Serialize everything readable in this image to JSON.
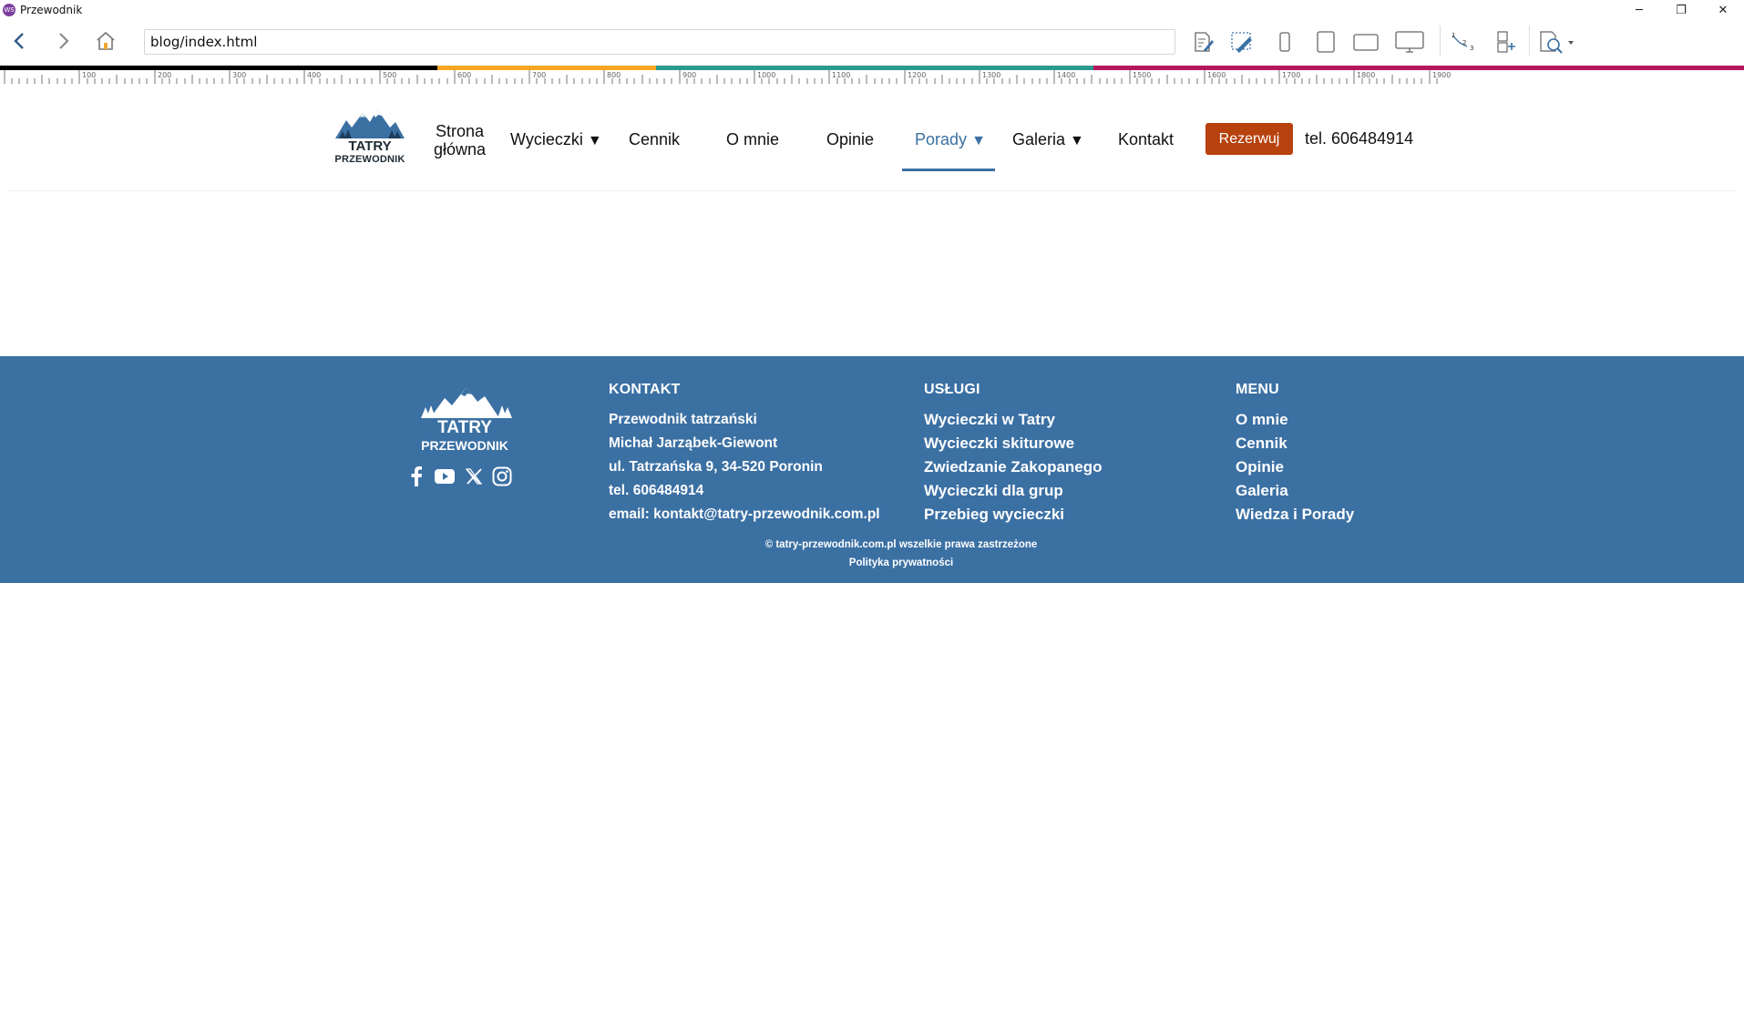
{
  "window": {
    "title": "Przewodnik",
    "app_icon": "WS",
    "minimize_icon": "─",
    "restore_icon": "❐",
    "close_icon": "✕"
  },
  "toolbar": {
    "address": "blog/index.html"
  },
  "ruler": {
    "labels": [
      "100",
      "200",
      "300",
      "400",
      "500",
      "600",
      "700",
      "800",
      "900",
      "1000",
      "1100",
      "1200",
      "1300",
      "1400",
      "1500",
      "1600",
      "1700",
      "1800",
      "1900"
    ],
    "band_colors": [
      "#000000",
      "#f5a623",
      "#2b9b8f",
      "#b5175c"
    ]
  },
  "header": {
    "logo_line1": "TATRY",
    "logo_line2": "PRZEWODNIK",
    "menu": {
      "home_line1": "Strona",
      "home_line2": "główna",
      "tours": "Wycieczki",
      "pricing": "Cennik",
      "about": "O mnie",
      "reviews": "Opinie",
      "tips": "Porady",
      "gallery": "Galeria",
      "contact": "Kontakt"
    },
    "caret": "▼",
    "reserve_label": "Rezerwuj",
    "phone": "tel. 606484914",
    "accent_color": "#3b70a3",
    "button_color": "#b7420e"
  },
  "footer": {
    "background": "#3b70a3",
    "logo_line1": "TATRY",
    "logo_line2": "PRZEWODNIK",
    "contact": {
      "heading": "KONTAKT",
      "lines": [
        "Przewodnik tatrzański",
        "Michał Jarząbek-Giewont",
        "ul. Tatrzańska 9, 34-520 Poronin",
        "tel. 606484914",
        "email: kontakt@tatry-przewodnik.com.pl"
      ]
    },
    "services": {
      "heading": "USŁUGI",
      "links": [
        "Wycieczki w Tatry",
        "Wycieczki skiturowe",
        "Zwiedzanie Zakopanego",
        "Wycieczki dla grup",
        "Przebieg wycieczki"
      ]
    },
    "menu": {
      "heading": "MENU",
      "links": [
        "O mnie",
        "Cennik",
        "Opinie",
        "Galeria",
        "Wiedza i Porady"
      ]
    },
    "copyright": "© tatry-przewodnik.com.pl wszelkie prawa zastrzeżone",
    "privacy": "Polityka prywatności"
  }
}
